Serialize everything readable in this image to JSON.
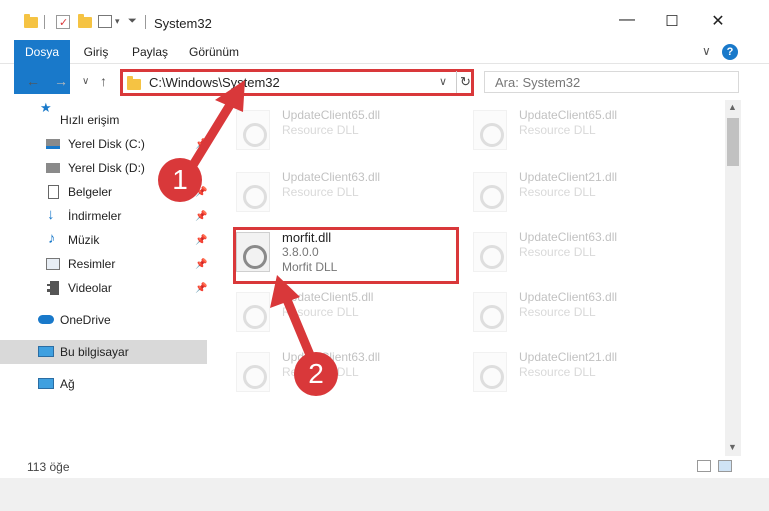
{
  "window": {
    "title": "System32",
    "minimize": "—",
    "maximize": "☐",
    "close": "✕"
  },
  "ribbon": {
    "tabs": [
      "Dosya",
      "Giriş",
      "Paylaş",
      "Görünüm"
    ],
    "help": "?",
    "collapse": "∨"
  },
  "nav_buttons": {
    "back": "←",
    "forward": "→",
    "recent": "∨",
    "up": "↑"
  },
  "address": {
    "path": "C:\\Windows\\System32",
    "dropdown": "∨",
    "refresh": "↻"
  },
  "search": {
    "placeholder": "Ara: System32"
  },
  "sidebar": {
    "items": [
      {
        "label": "Hızlı erişim",
        "icon": "star-icon"
      },
      {
        "label": "Yerel Disk (C:)",
        "icon": "drive-icon"
      },
      {
        "label": "Yerel Disk (D:)",
        "icon": "drive-icon"
      },
      {
        "label": "Belgeler",
        "icon": "documents-icon"
      },
      {
        "label": "İndirmeler",
        "icon": "download-icon"
      },
      {
        "label": "Müzik",
        "icon": "music-icon"
      },
      {
        "label": "Resimler",
        "icon": "pictures-icon"
      },
      {
        "label": "Videolar",
        "icon": "videos-icon"
      },
      {
        "label": "OneDrive",
        "icon": "cloud-icon"
      },
      {
        "label": "Bu bilgisayar",
        "icon": "computer-icon"
      },
      {
        "label": "Ağ",
        "icon": "network-icon"
      }
    ]
  },
  "files": {
    "col1": [
      {
        "name": "UpdateClient65.dll",
        "desc": "Resource DLL"
      },
      {
        "name": "UpdateClient63.dll",
        "desc": "Resource DLL"
      },
      {
        "name": "morfit.dll",
        "version": "3.8.0.0",
        "desc": "Morfit DLL"
      },
      {
        "name": "UpdateClient5.dll",
        "desc": "Resource DLL"
      },
      {
        "name": "UpdateClient63.dll",
        "desc": "Resource DLL"
      }
    ],
    "col2": [
      {
        "name": "UpdateClient65.dll",
        "desc": "Resource DLL"
      },
      {
        "name": "UpdateClient21.dll",
        "desc": "Resource DLL"
      },
      {
        "name": "UpdateClient63.dll",
        "desc": "Resource DLL"
      },
      {
        "name": "UpdateClient63.dll",
        "desc": "Resource DLL"
      },
      {
        "name": "UpdateClient21.dll",
        "desc": "Resource DLL"
      }
    ]
  },
  "status": {
    "count": "113 öğe"
  },
  "annotations": {
    "step1": "1",
    "step2": "2",
    "color": "#d9383a"
  }
}
